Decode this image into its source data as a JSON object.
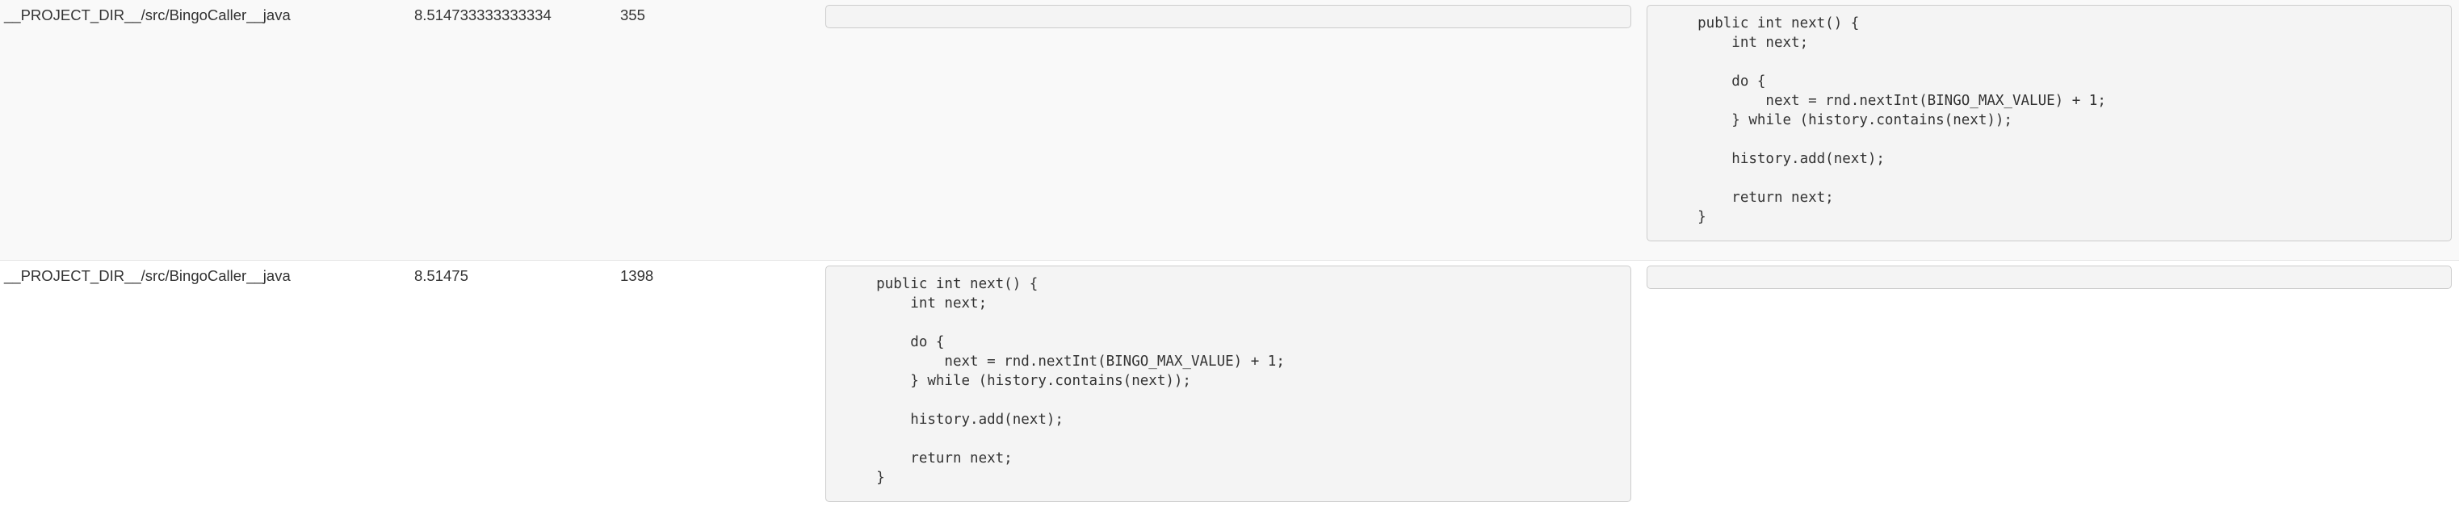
{
  "rows": [
    {
      "path": "__PROJECT_DIR__/src/BingoCaller__java",
      "score": "8.514733333333334",
      "line": "355",
      "code_left": "",
      "code_right": "    public int next() {\n        int next;\n\n        do {\n            next = rnd.nextInt(BINGO_MAX_VALUE) + 1;\n        } while (history.contains(next));\n\n        history.add(next);\n\n        return next;\n    }"
    },
    {
      "path": "__PROJECT_DIR__/src/BingoCaller__java",
      "score": "8.51475",
      "line": "1398",
      "code_left": "    public int next() {\n        int next;\n\n        do {\n            next = rnd.nextInt(BINGO_MAX_VALUE) + 1;\n        } while (history.contains(next));\n\n        history.add(next);\n\n        return next;\n    }",
      "code_right": ""
    }
  ]
}
